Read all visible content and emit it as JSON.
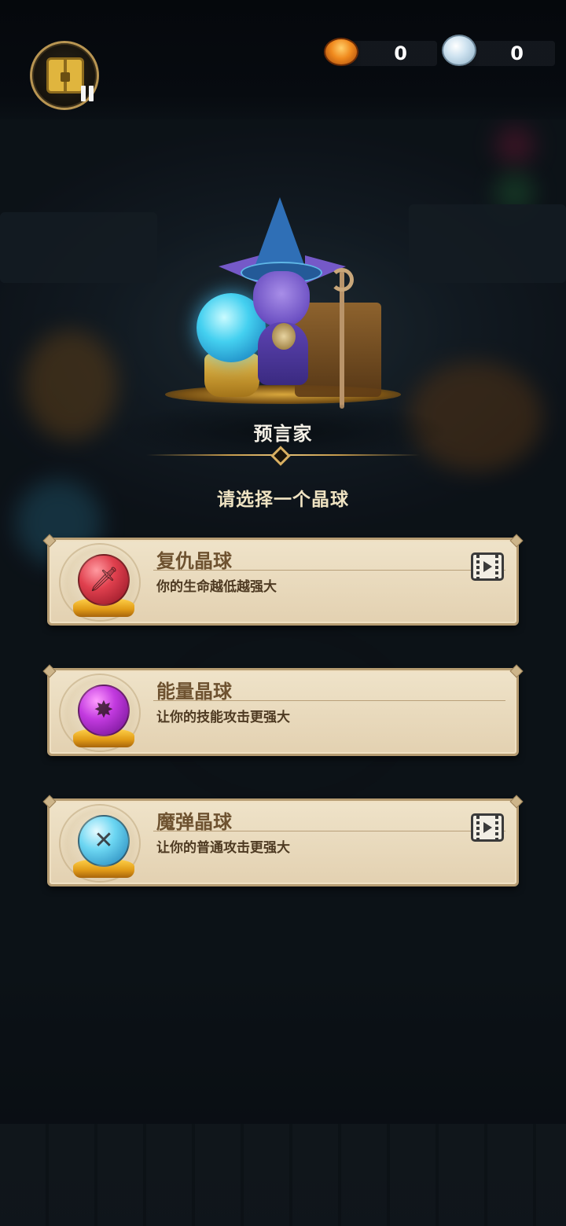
{
  "currency": {
    "coins": {
      "icon": "gold-coin-icon",
      "value": "0"
    },
    "gems": {
      "icon": "crystal-gem-icon",
      "value": "0"
    }
  },
  "npc": {
    "name": "预言家"
  },
  "prompt": "请选择一个晶球",
  "options": [
    {
      "name": "复仇晶球",
      "description": "你的生命越低越强大",
      "orb_icon": "dagger-icon",
      "orb_color": "#e0404e",
      "requires_video": true
    },
    {
      "name": "能量晶球",
      "description": "让你的技能攻击更强大",
      "orb_icon": "burst-icon",
      "orb_color": "#c23adf",
      "requires_video": false
    },
    {
      "name": "魔弹晶球",
      "description": "让你的普通攻击更强大",
      "orb_icon": "crossed-arrows-icon",
      "orb_color": "#6cd6f2",
      "requires_video": true
    }
  ],
  "colors": {
    "card_bg": "#efe3c9",
    "card_border": "#b69c72",
    "title_gold": "#c49a4c"
  }
}
